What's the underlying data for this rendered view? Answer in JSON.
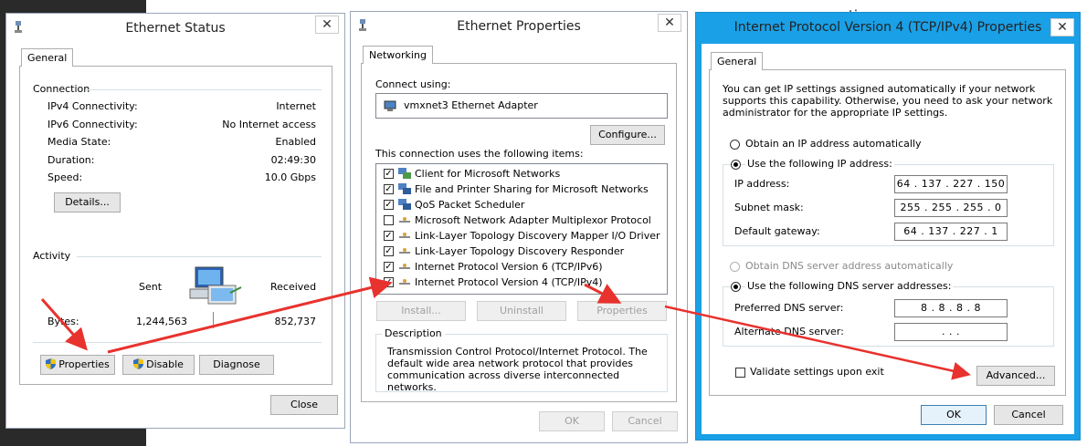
{
  "background": {
    "fragment_text": "setions"
  },
  "ethernet_status": {
    "title": "Ethernet Status",
    "tab": "General",
    "connection_label": "Connection",
    "rows": [
      {
        "label": "IPv4 Connectivity:",
        "value": "Internet"
      },
      {
        "label": "IPv6 Connectivity:",
        "value": "No Internet access"
      },
      {
        "label": "Media State:",
        "value": "Enabled"
      },
      {
        "label": "Duration:",
        "value": "02:49:30"
      },
      {
        "label": "Speed:",
        "value": "10.0 Gbps"
      }
    ],
    "details_button": "Details...",
    "activity_label": "Activity",
    "sent_label": "Sent",
    "received_label": "Received",
    "bytes_label": "Bytes:",
    "bytes_sent": "1,244,563",
    "bytes_received": "852,737",
    "properties_button": "Properties",
    "disable_button": "Disable",
    "diagnose_button": "Diagnose",
    "close_button": "Close"
  },
  "ethernet_properties": {
    "title": "Ethernet Properties",
    "tab": "Networking",
    "connect_using_label": "Connect using:",
    "adapter_name": "vmxnet3 Ethernet Adapter",
    "configure_button": "Configure...",
    "items_label": "This connection uses the following items:",
    "items": [
      {
        "label": "Client for Microsoft Networks",
        "checked": true
      },
      {
        "label": "File and Printer Sharing for Microsoft Networks",
        "checked": true
      },
      {
        "label": "QoS Packet Scheduler",
        "checked": true
      },
      {
        "label": "Microsoft Network Adapter Multiplexor Protocol",
        "checked": false
      },
      {
        "label": "Link-Layer Topology Discovery Mapper I/O Driver",
        "checked": true
      },
      {
        "label": "Link-Layer Topology Discovery Responder",
        "checked": true
      },
      {
        "label": "Internet Protocol Version 6 (TCP/IPv6)",
        "checked": true
      },
      {
        "label": "Internet Protocol Version 4 (TCP/IPv4)",
        "checked": true
      }
    ],
    "install_button": "Install...",
    "uninstall_button": "Uninstall",
    "properties_button": "Properties",
    "description_label": "Description",
    "description_text": "Transmission Control Protocol/Internet Protocol. The default wide area network protocol that provides communication across diverse interconnected networks.",
    "ok_button": "OK",
    "cancel_button": "Cancel"
  },
  "ipv4_properties": {
    "title": "Internet Protocol Version 4 (TCP/IPv4) Properties",
    "tab": "General",
    "intro_text": "You can get IP settings assigned automatically if your network supports this capability. Otherwise, you need to ask your network administrator for the appropriate IP settings.",
    "obtain_ip_auto": "Obtain an IP address automatically",
    "use_following_ip": "Use the following IP address:",
    "ip_address_label": "IP address:",
    "ip_address": "64 . 137 . 227 . 150",
    "subnet_mask_label": "Subnet mask:",
    "subnet_mask": "255 . 255 . 255 . 0",
    "default_gateway_label": "Default gateway:",
    "default_gateway": "64 . 137 . 227 . 1",
    "obtain_dns_auto": "Obtain DNS server address automatically",
    "use_following_dns": "Use the following DNS server addresses:",
    "preferred_dns_label": "Preferred DNS server:",
    "preferred_dns": "8 . 8 . 8 . 8",
    "alternate_dns_label": "Alternate DNS server:",
    "alternate_dns": ". . .",
    "validate_label": "Validate settings upon exit",
    "advanced_button": "Advanced...",
    "ok_button": "OK",
    "cancel_button": "Cancel"
  },
  "colors": {
    "title_bar_active": "#1aa0e6",
    "title_bar_inactive": "#ffffff",
    "annotation_arrow": "#e8322e"
  }
}
